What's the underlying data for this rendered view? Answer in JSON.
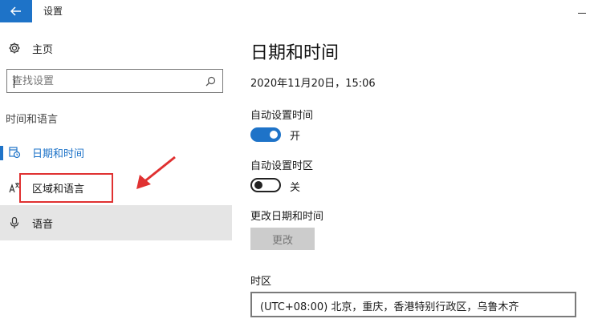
{
  "window": {
    "title": "设置"
  },
  "sidebar": {
    "home_label": "主页",
    "search_placeholder": "查找设置",
    "section_label": "时间和语言",
    "items": [
      {
        "label": "日期和时间",
        "icon": "calendar-clock-icon",
        "selected": true
      },
      {
        "label": "区域和语言",
        "icon": "language-icon",
        "selected": false
      },
      {
        "label": "语音",
        "icon": "microphone-icon",
        "selected": false
      }
    ]
  },
  "main": {
    "title": "日期和时间",
    "current_datetime": "2020年11月20日，15:06",
    "auto_time": {
      "label": "自动设置时间",
      "state": "开",
      "on": true
    },
    "auto_timezone": {
      "label": "自动设置时区",
      "state": "关",
      "on": false
    },
    "change_datetime": {
      "label": "更改日期和时间",
      "button_label": "更改"
    },
    "timezone": {
      "label": "时区",
      "value": "(UTC+08:00) 北京，重庆，香港特别行政区，乌鲁木齐"
    }
  },
  "colors": {
    "accent": "#1e73c8",
    "annotation": "#e03131",
    "hover_bg": "#e5e5e5"
  }
}
